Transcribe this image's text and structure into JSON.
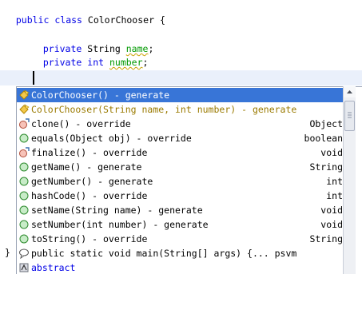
{
  "editor": {
    "line1": {
      "kw1": "public",
      "kw2": "class",
      "name": "ColorChooser",
      "brace": "{"
    },
    "line2": {
      "kw": "private",
      "type": "String",
      "field": "name",
      "semi": ";"
    },
    "line3": {
      "kw1": "private",
      "kw2": "int",
      "field": "number",
      "semi": ";"
    },
    "left_brace": "}"
  },
  "completion": {
    "items": [
      {
        "text": "ColorChooser() - generate",
        "type": ""
      },
      {
        "text": "ColorChooser(String name, int number) - generate",
        "type": ""
      },
      {
        "text": "clone() - override",
        "type": "Object"
      },
      {
        "text": "equals(Object obj) - override",
        "type": "boolean"
      },
      {
        "text": "finalize() - override",
        "type": "void"
      },
      {
        "text": "getName() - generate",
        "type": "String"
      },
      {
        "text": "getNumber() - generate",
        "type": "int"
      },
      {
        "text": "hashCode() - override",
        "type": "int"
      },
      {
        "text": "setName(String name) - generate",
        "type": "void"
      },
      {
        "text": "setNumber(int number) - generate",
        "type": "void"
      },
      {
        "text": "toString() - override",
        "type": "String"
      },
      {
        "text": "public static void main(String[] args) {... psvm",
        "type": ""
      },
      {
        "text": "abstract",
        "type": ""
      }
    ]
  },
  "colors": {
    "keyword": "#0000e6",
    "field": "#009900",
    "selection": "#3875d7",
    "param": "#a020a0"
  }
}
